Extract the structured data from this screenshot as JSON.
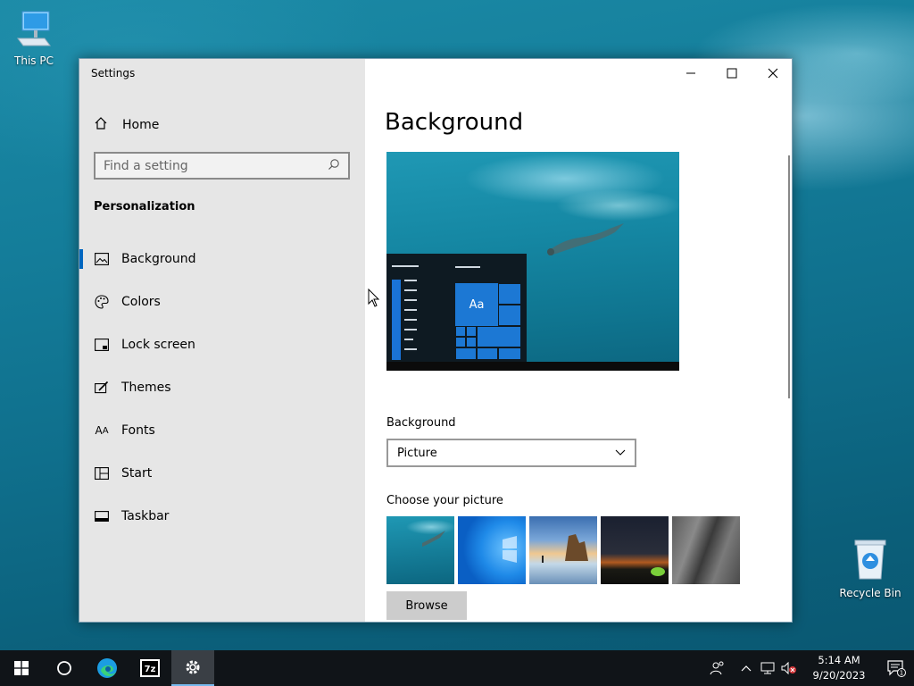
{
  "desktop": {
    "icons": [
      {
        "label": "This PC"
      },
      {
        "label": "Recycle Bin"
      }
    ]
  },
  "window": {
    "title": "Settings",
    "sidebar": {
      "home_label": "Home",
      "search_placeholder": "Find a setting",
      "section_title": "Personalization",
      "items": [
        {
          "label": "Background",
          "icon": "picture-icon",
          "active": true
        },
        {
          "label": "Colors",
          "icon": "palette-icon"
        },
        {
          "label": "Lock screen",
          "icon": "lock-screen-icon"
        },
        {
          "label": "Themes",
          "icon": "themes-icon"
        },
        {
          "label": "Fonts",
          "icon": "fonts-icon"
        },
        {
          "label": "Start",
          "icon": "start-icon"
        },
        {
          "label": "Taskbar",
          "icon": "taskbar-icon"
        }
      ]
    },
    "content": {
      "page_title": "Background",
      "preview_tile_text": "Aa",
      "background_label": "Background",
      "background_value": "Picture",
      "choose_picture_label": "Choose your picture",
      "browse_label": "Browse"
    }
  },
  "taskbar": {
    "clock_time": "5:14 AM",
    "clock_date": "9/20/2023",
    "notification_count": "1",
    "pinned": [
      "start-button",
      "cortana-button",
      "edge-icon",
      "7zip-icon",
      "settings-icon"
    ]
  },
  "colors": {
    "accent": "#0067c0",
    "sidebar_bg": "#e6e6e6",
    "taskbar_bg": "#101418"
  }
}
